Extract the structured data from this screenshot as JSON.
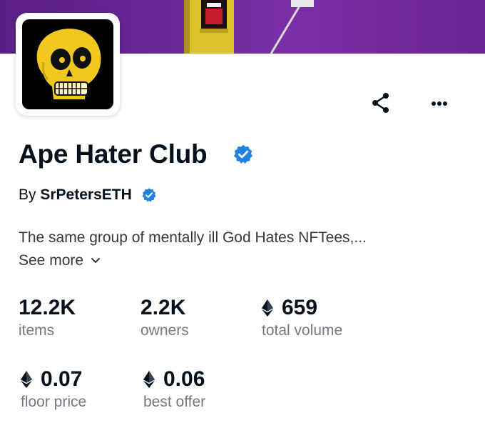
{
  "collection": {
    "name": "Ape Hater Club",
    "creator_prefix": "By",
    "creator": "SrPetersETH",
    "description": "The same group of mentally ill God Hates NFTees,...",
    "see_more": "See more"
  },
  "stats": [
    {
      "value": "12.2K",
      "label": "items",
      "eth": false
    },
    {
      "value": "2.2K",
      "label": "owners",
      "eth": false
    },
    {
      "value": "659",
      "label": "total volume",
      "eth": true
    },
    {
      "value": "0.07",
      "label": "floor price",
      "eth": true
    },
    {
      "value": "0.06",
      "label": "best offer",
      "eth": true
    }
  ],
  "icons": {
    "share": "share-icon",
    "more": "more-horizontal-icon",
    "verified": "verified-badge-icon",
    "eth": "ethereum-icon",
    "chevron": "chevron-down-icon"
  },
  "colors": {
    "banner": "#6b2a9a",
    "verified": "#2081e2",
    "text": "#04111d",
    "muted": "#707a83",
    "skull": "#f0c81e"
  }
}
